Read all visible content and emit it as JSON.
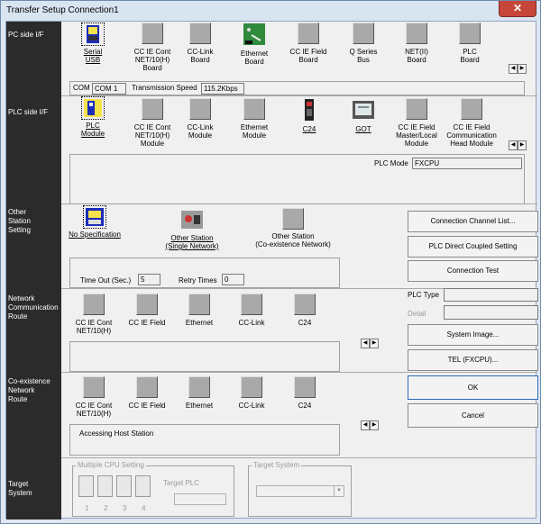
{
  "window": {
    "title": "Transfer Setup Connection1",
    "close": "✕"
  },
  "sections": {
    "pc_if": "PC side I/F",
    "plc_if": "PLC side I/F",
    "other": "Other\nStation\nSetting",
    "network": "Network\nCommunication\nRoute",
    "coexist": "Co-existence\nNetwork\nRoute",
    "target": "Target\nSystem"
  },
  "pc_items": [
    "Serial\nUSB",
    "CC IE Cont\nNET/10(H)\nBoard",
    "CC-Link\nBoard",
    "Ethernet\nBoard",
    "CC IE Field\nBoard",
    "Q Series\nBus",
    "NET(II)\nBoard",
    "PLC\nBoard"
  ],
  "com": {
    "label": "COM",
    "port": "COM 1",
    "speed_label": "Transmission Speed",
    "speed": "115.2Kbps"
  },
  "plc_items": [
    "PLC\nModule",
    "CC IE Cont\nNET/10(H)\nModule",
    "CC-Link\nModule",
    "Ethernet\nModule",
    "C24",
    "GOT",
    "CC IE Field\nMaster/Local\nModule",
    "CC IE Field\nCommunication\nHead Module"
  ],
  "plc_mode": {
    "label": "PLC Mode",
    "value": "FXCPU"
  },
  "other_items": [
    "No Specification",
    "Other Station\n(Single Network)",
    "Other Station\n(Co-existence Network)"
  ],
  "timeout": {
    "label": "Time Out (Sec.)",
    "value": "5",
    "retry_label": "Retry Times",
    "retry": "0"
  },
  "net_items": [
    "CC IE Cont\nNET/10(H)",
    "CC IE Field",
    "Ethernet",
    "CC-Link",
    "C24"
  ],
  "coexist_items": [
    "CC IE Cont\nNET/10(H)",
    "CC IE Field",
    "Ethernet",
    "CC-Link",
    "C24"
  ],
  "accessing": "Accessing Host Station",
  "multi_cpu": {
    "label": "Multiple CPU Setting",
    "nums": [
      "1",
      "2",
      "3",
      "4"
    ],
    "target_plc": "Target PLC"
  },
  "target_system": "Target System",
  "buttons": {
    "channel": "Connection Channel List...",
    "direct": "PLC Direct Coupled Setting",
    "test": "Connection Test",
    "system_image": "System Image...",
    "tel": "TEL (FXCPU)...",
    "ok": "OK",
    "cancel": "Cancel"
  },
  "side": {
    "plc_type": "PLC Type",
    "detail": "Detail"
  },
  "arrows": {
    "left": "◀",
    "right": "▶"
  }
}
